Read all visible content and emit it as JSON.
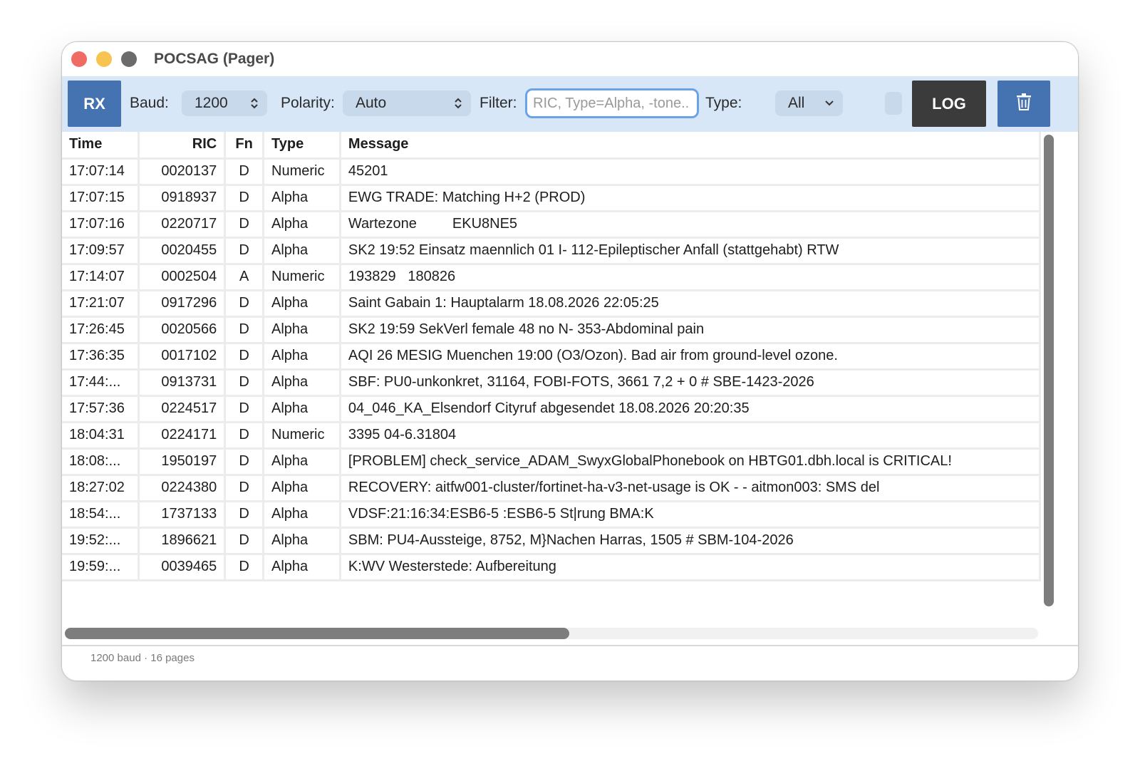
{
  "window": {
    "title": "POCSAG (Pager)"
  },
  "toolbar": {
    "rx_label": "RX",
    "baud_label": "Baud:",
    "baud_value": "1200",
    "polarity_label": "Polarity:",
    "polarity_value": "Auto",
    "filter_label": "Filter:",
    "filter_placeholder": "RIC, Type=Alpha, -tone..",
    "type_label": "Type:",
    "type_value": "All",
    "log_label": "LOG",
    "trash_icon": "trash-icon"
  },
  "table": {
    "headers": {
      "time": "Time",
      "ric": "RIC",
      "fn": "Fn",
      "type": "Type",
      "message": "Message"
    },
    "rows": [
      {
        "time": "17:07:14",
        "ric": "0020137",
        "fn": "D",
        "type": "Numeric",
        "message": "45201"
      },
      {
        "time": "17:07:15",
        "ric": "0918937",
        "fn": "D",
        "type": "Alpha",
        "message": "EWG TRADE: Matching H+2 (PROD)"
      },
      {
        "time": "17:07:16",
        "ric": "0220717",
        "fn": "D",
        "type": "Alpha",
        "message": "Wartezone         EKU8NE5"
      },
      {
        "time": "17:09:57",
        "ric": "0020455",
        "fn": "D",
        "type": "Alpha",
        "message": "SK2 19:52 Einsatz maennlich 01 I- 112-Epileptischer Anfall (stattgehabt) RTW"
      },
      {
        "time": "17:14:07",
        "ric": "0002504",
        "fn": "A",
        "type": "Numeric",
        "message": "193829   180826"
      },
      {
        "time": "17:21:07",
        "ric": "0917296",
        "fn": "D",
        "type": "Alpha",
        "message": "Saint Gabain 1: Hauptalarm 18.08.2026 22:05:25"
      },
      {
        "time": "17:26:45",
        "ric": "0020566",
        "fn": "D",
        "type": "Alpha",
        "message": "SK2 19:59 SekVerl female 48 no N- 353-Abdominal pain"
      },
      {
        "time": "17:36:35",
        "ric": "0017102",
        "fn": "D",
        "type": "Alpha",
        "message": "AQI 26 MESIG Muenchen 19:00 (O3/Ozon). Bad air from ground-level ozone."
      },
      {
        "time": "17:44:...",
        "ric": "0913731",
        "fn": "D",
        "type": "Alpha",
        "message": "SBF: PU0-unkonkret, 31164, FOBI-FOTS, 3661 7,2 + 0 # SBE-1423-2026"
      },
      {
        "time": "17:57:36",
        "ric": "0224517",
        "fn": "D",
        "type": "Alpha",
        "message": "04_046_KA_Elsendorf Cityruf abgesendet 18.08.2026 20:20:35"
      },
      {
        "time": "18:04:31",
        "ric": "0224171",
        "fn": "D",
        "type": "Numeric",
        "message": "3395 04-6.31804"
      },
      {
        "time": "18:08:...",
        "ric": "1950197",
        "fn": "D",
        "type": "Alpha",
        "message": "[PROBLEM] check_service_ADAM_SwyxGlobalPhonebook on HBTG01.dbh.local is CRITICAL!"
      },
      {
        "time": "18:27:02",
        "ric": "0224380",
        "fn": "D",
        "type": "Alpha",
        "message": "RECOVERY: aitfw001-cluster/fortinet-ha-v3-net-usage is OK - - aitmon003: SMS del"
      },
      {
        "time": "18:54:...",
        "ric": "1737133",
        "fn": "D",
        "type": "Alpha",
        "message": "VDSF:21:16:34:ESB6-5 :ESB6-5 St|rung BMA:K"
      },
      {
        "time": "19:52:...",
        "ric": "1896621",
        "fn": "D",
        "type": "Alpha",
        "message": "SBM: PU4-Aussteige, 8752, M}Nachen Harras, 1505 # SBM-104-2026"
      },
      {
        "time": "19:59:...",
        "ric": "0039465",
        "fn": "D",
        "type": "Alpha",
        "message": "K:WV Westerstede: Aufbereitung"
      }
    ]
  },
  "status": {
    "text": "1200 baud · 16 pages"
  }
}
